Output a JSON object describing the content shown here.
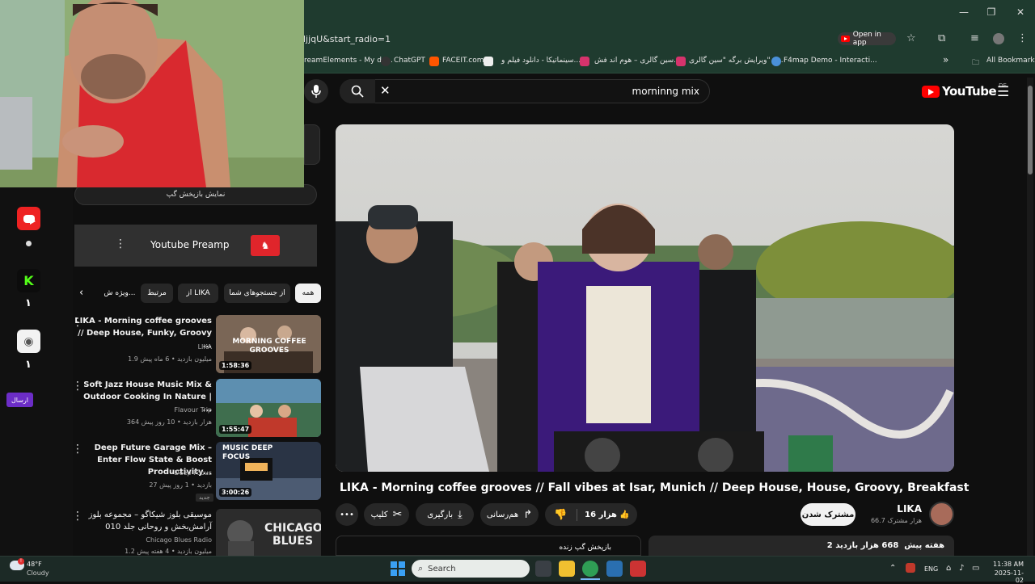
{
  "browser": {
    "url": "ljjqU&start_radio=1",
    "open_in_app": "Open in app",
    "bookmarks": [
      {
        "label": "reamElements - My da..."
      },
      {
        "label": "ChatGPT"
      },
      {
        "label": "FACEIT.com"
      },
      {
        "label": "سینماتیکا - دانلود فیلم و..."
      },
      {
        "label": "سین گالری – هوم اند فش..."
      },
      {
        "label": "ویرایش برگه \"سین گالری\" –..."
      },
      {
        "label": "F4map Demo - Interacti..."
      }
    ],
    "all_bookmarks": "All Bookmarks",
    "overflow": "»"
  },
  "search": {
    "query": "morninng mix"
  },
  "youtube": {
    "logo_text": "YouTube",
    "region": "DE"
  },
  "video": {
    "title": "LIKA - Morning coffee grooves // Fall vibes at Isar, Munich // Deep House, House, Groovy, Breakfast",
    "actions": {
      "clip": "کلیپ",
      "download": "بارگیری",
      "share": "هم‌رسانی",
      "likes": "16 هزار"
    },
    "channel": {
      "name": "LIKA",
      "subs": "66.7 هزار مشترک",
      "subscribe": "مشترک شدن"
    },
    "stats": {
      "views": "668 هزار بازدید",
      "age": "2 هفته پیش"
    },
    "live_chat": "بازپخش گپ زنده"
  },
  "sidebar": {
    "show_chat": "نمایش بازپخش گپ",
    "extension": "Youtube Preamp",
    "chips": [
      "همه",
      "از جستجوهای شما",
      "از LIKA",
      "مرتبط",
      "ویژه ش..."
    ],
    "recommendations": [
      {
        "title": "LIKA - Morning coffee grooves // Deep House, Funky, Groovy ...",
        "channel": "LIKA",
        "meta": "1.9 میلیون بازدید • 6 ماه پیش",
        "duration": "1:58:36",
        "thumb_text": "MORNING COFFEE GROOVES"
      },
      {
        "title": "Soft Jazz House Music Mix & Outdoor Cooking In Nature | ...",
        "channel": "Flavour Trip",
        "meta": "364 هزار بازدید • 10 روز پیش",
        "duration": "1:55:47",
        "thumb_text": ""
      },
      {
        "title": "Deep Future Garage Mix – Enter Flow State & Boost Productivity...",
        "channel": "Deep Focus",
        "meta": "27 بازدید • 1 روز پیش",
        "duration": "3:00:26",
        "badge": "جدید",
        "thumb_text": "MUSIC DEEP FOCUS"
      },
      {
        "title": "موسیقی بلوز شیکاگو – مجموعه بلوز آرامش‌بخش و روحانی جلد 010",
        "channel": "Chicago Blues Radio",
        "meta": "1.2 میلیون بازدید • 4 هفته پیش",
        "duration": "",
        "thumb_text": "CHICAGO BLUES"
      }
    ]
  },
  "left_apps": {
    "badge1": "۱",
    "badge2": "۱",
    "send": "ارسال"
  },
  "taskbar": {
    "weather_temp": "48°F",
    "weather_desc": "Cloudy",
    "search": "Search",
    "lang": "ENG",
    "time": "11:38 AM",
    "date": "2025-11-02"
  }
}
